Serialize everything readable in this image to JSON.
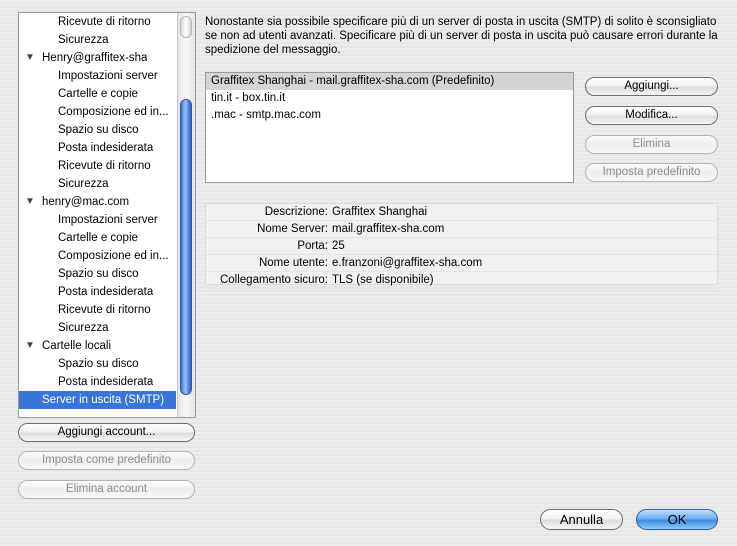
{
  "sidebar": {
    "items": [
      {
        "label": "Ricevute di ritorno",
        "level": "child"
      },
      {
        "label": "Sicurezza",
        "level": "child"
      },
      {
        "label": "Henry@graffitex-sha",
        "level": "parent"
      },
      {
        "label": "Impostazioni server",
        "level": "child"
      },
      {
        "label": "Cartelle e copie",
        "level": "child"
      },
      {
        "label": "Composizione ed in...",
        "level": "child"
      },
      {
        "label": "Spazio su disco",
        "level": "child"
      },
      {
        "label": "Posta indesiderata",
        "level": "child"
      },
      {
        "label": "Ricevute di ritorno",
        "level": "child"
      },
      {
        "label": "Sicurezza",
        "level": "child"
      },
      {
        "label": "henry@mac.com",
        "level": "parent"
      },
      {
        "label": "Impostazioni server",
        "level": "child"
      },
      {
        "label": "Cartelle e copie",
        "level": "child"
      },
      {
        "label": "Composizione ed in...",
        "level": "child"
      },
      {
        "label": "Spazio su disco",
        "level": "child"
      },
      {
        "label": "Posta indesiderata",
        "level": "child"
      },
      {
        "label": "Ricevute di ritorno",
        "level": "child"
      },
      {
        "label": "Sicurezza",
        "level": "child"
      },
      {
        "label": "Cartelle locali",
        "level": "parent"
      },
      {
        "label": "Spazio su disco",
        "level": "child"
      },
      {
        "label": "Posta indesiderata",
        "level": "child"
      },
      {
        "label": "Server in uscita (SMTP)",
        "level": "child",
        "selected": true
      }
    ],
    "disclosure_glyph": "▼",
    "add_account": "Aggiungi account...",
    "set_default": "Imposta come predefinito",
    "delete_account": "Elimina account"
  },
  "main": {
    "description": "Nonostante sia possibile specificare più di un server di posta in uscita (SMTP) di solito è sconsigliato se non ad utenti avanzati. Specificare più di un server di posta in uscita può causare errori durante la spedizione del messaggio.",
    "servers": [
      "Graffitex Shanghai - mail.graffitex-sha.com (Predefinito)",
      "tin.it - box.tin.it",
      ".mac - smtp.mac.com"
    ],
    "selected_server": 0,
    "buttons": {
      "add": "Aggiungi...",
      "edit": "Modifica...",
      "delete": "Elimina",
      "set_default": "Imposta predefinito"
    },
    "details": [
      {
        "key": "Descrizione:",
        "value": "Graffitex Shanghai"
      },
      {
        "key": "Nome Server:",
        "value": "mail.graffitex-sha.com"
      },
      {
        "key": "Porta:",
        "value": "25"
      },
      {
        "key": "Nome utente:",
        "value": "e.franzoni@graffitex-sha.com"
      },
      {
        "key": "Collegamento sicuro:",
        "value": "TLS (se disponibile)"
      }
    ]
  },
  "footer": {
    "cancel": "Annulla",
    "ok": "OK"
  },
  "colors": {
    "selection": "#3875d7",
    "default_button": "#3f8de0"
  }
}
